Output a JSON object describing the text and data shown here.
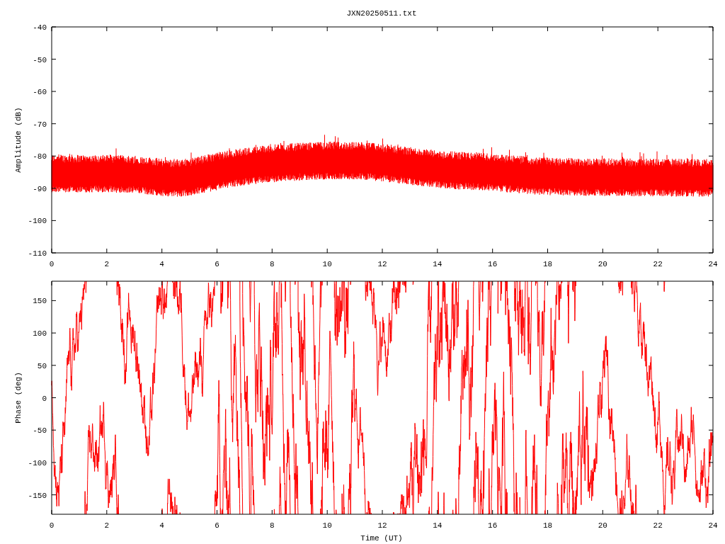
{
  "title": "JXN20250511.txt",
  "panels": [
    {
      "kind": "amplitude",
      "ylabel": "Amplitude (dB)",
      "yticks": [
        "-40",
        "-50",
        "-60",
        "-70",
        "-80",
        "-90",
        "-100",
        "-110"
      ],
      "xticks": [
        "0",
        "2",
        "4",
        "6",
        "8",
        "10",
        "12",
        "14",
        "16",
        "18",
        "20",
        "22",
        "24"
      ]
    },
    {
      "kind": "phase",
      "ylabel": "Phase (deg)",
      "yticks": [
        "150",
        "100",
        "50",
        "0",
        "-50",
        "-100",
        "-150"
      ],
      "xticks": [
        "0",
        "2",
        "4",
        "6",
        "8",
        "10",
        "12",
        "14",
        "16",
        "18",
        "20",
        "22",
        "24"
      ],
      "xlabel": "Time (UT)"
    }
  ]
}
